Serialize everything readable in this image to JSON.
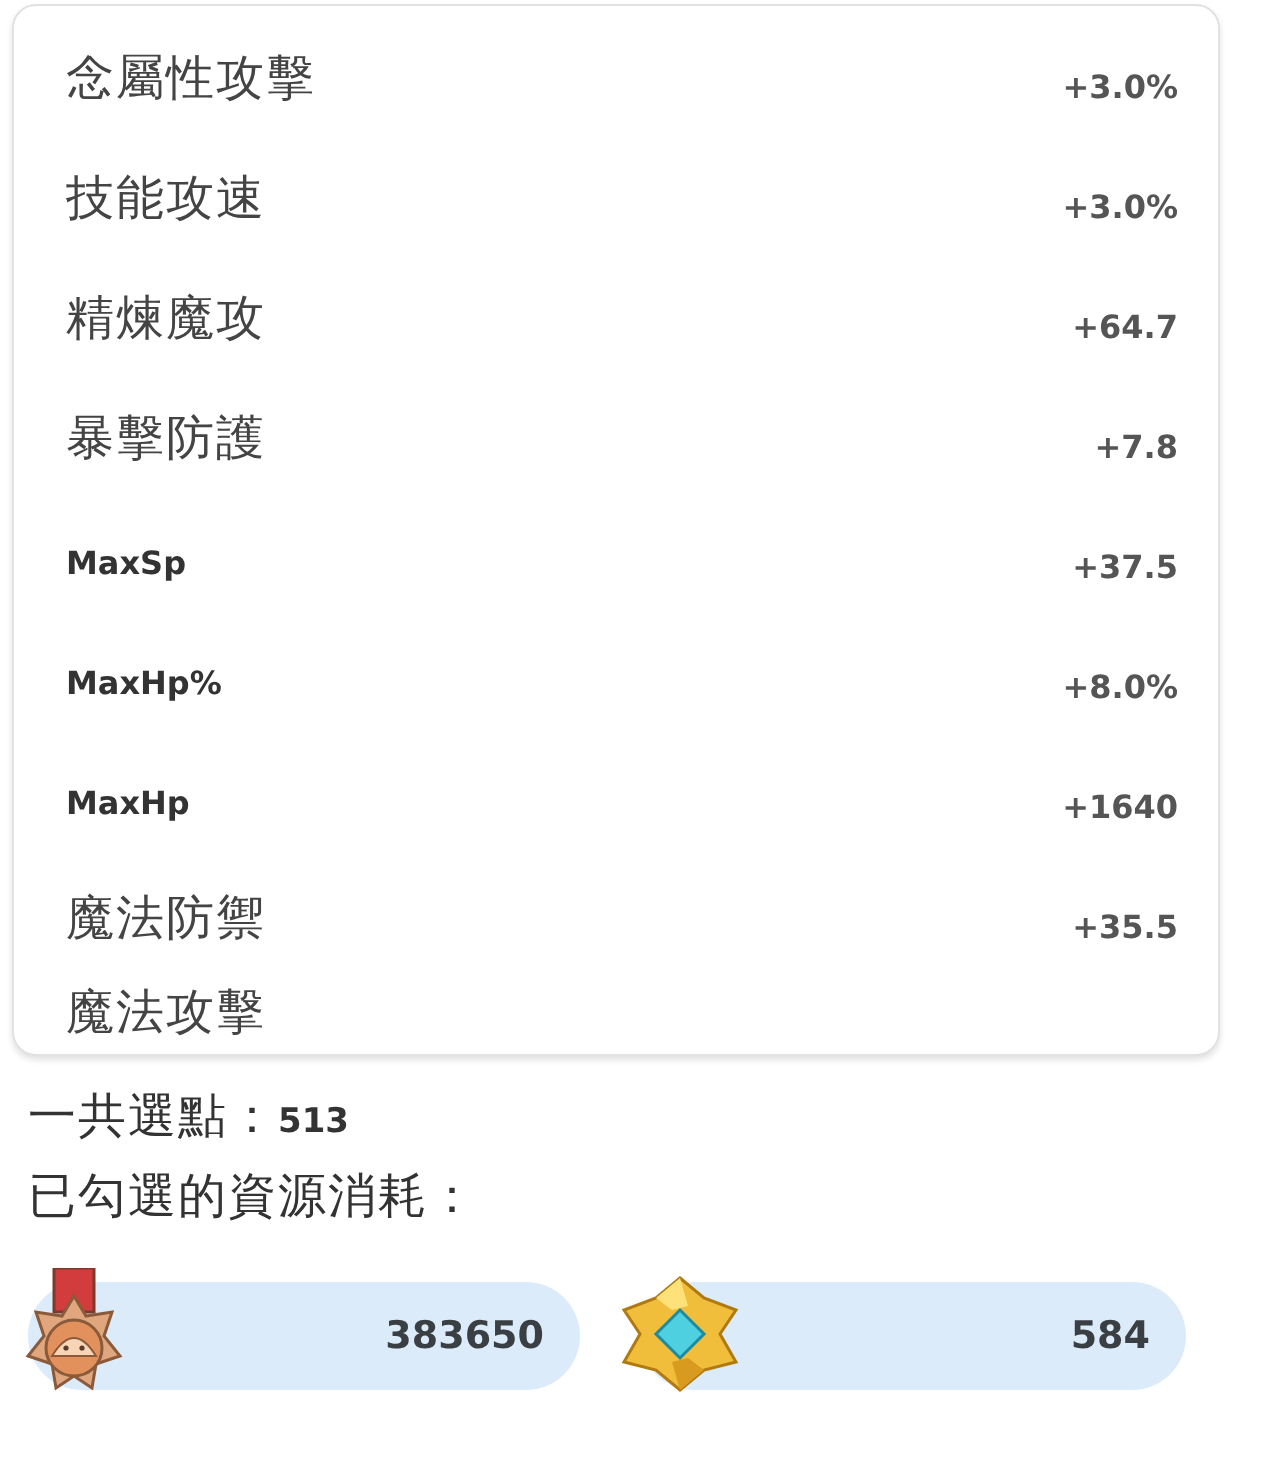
{
  "stats": [
    {
      "name": "念屬性攻擊",
      "value": "+3.0%"
    },
    {
      "name": "技能攻速",
      "value": "+3.0%"
    },
    {
      "name": "精煉魔攻",
      "value": "+64.7"
    },
    {
      "name": "暴擊防護",
      "value": "+7.8"
    },
    {
      "name": "MaxSp",
      "value": "+37.5"
    },
    {
      "name": "MaxHp%",
      "value": "+8.0%"
    },
    {
      "name": "MaxHp",
      "value": "+1640"
    },
    {
      "name": "魔法防禦",
      "value": "+35.5"
    },
    {
      "name": "魔法攻擊"
    }
  ],
  "total": {
    "label": "一共選點：",
    "value": "513"
  },
  "cost_label": "已勾選的資源消耗：",
  "costs": [
    {
      "kind": "medal",
      "amount": "383650"
    },
    {
      "kind": "crystal",
      "amount": "584"
    }
  ]
}
